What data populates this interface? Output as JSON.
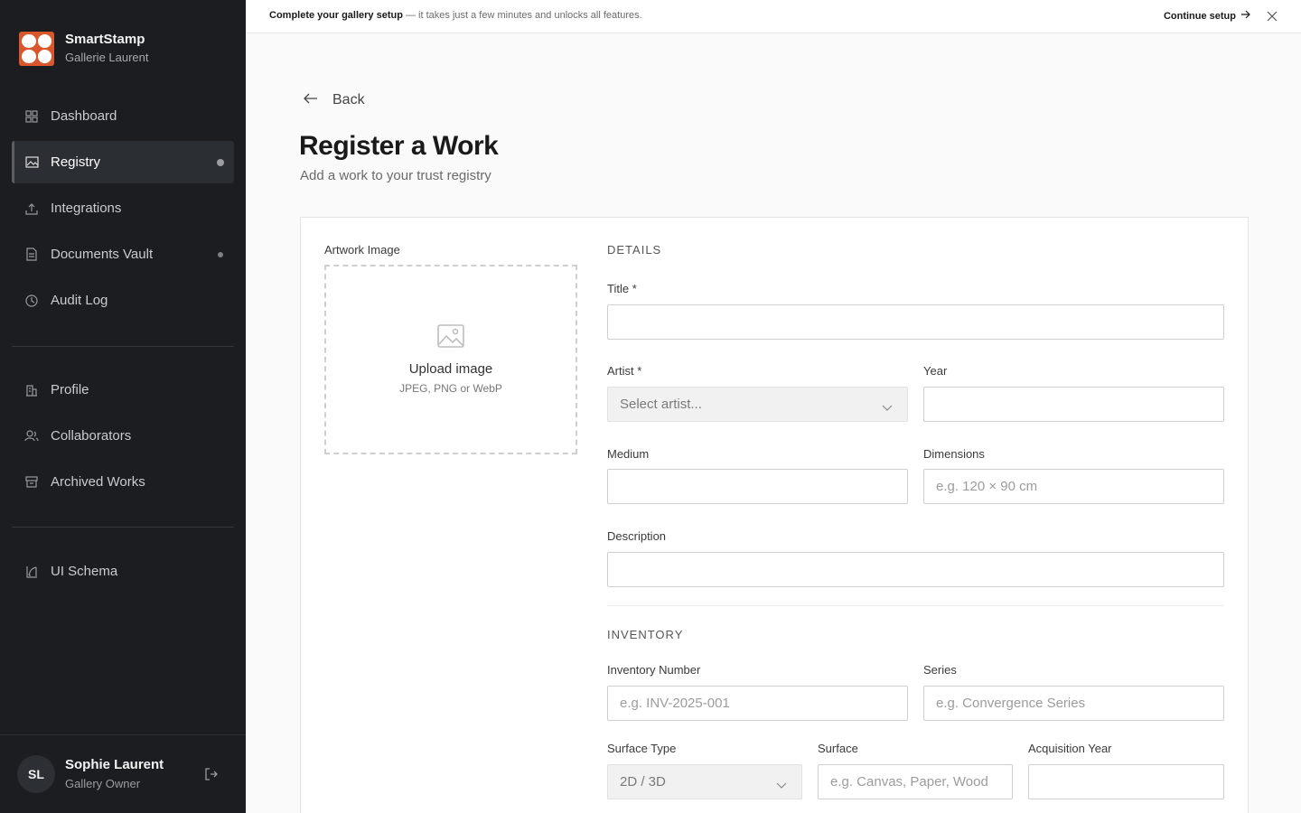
{
  "brand": {
    "name": "SmartStamp",
    "org": "Gallerie Laurent",
    "accent": "#d9572d"
  },
  "nav": {
    "primary": [
      {
        "label": "Dashboard",
        "icon": "grid-icon"
      },
      {
        "label": "Registry",
        "icon": "image-icon",
        "active": true
      },
      {
        "label": "Integrations",
        "icon": "upload-icon"
      },
      {
        "label": "Documents Vault",
        "icon": "document-icon"
      },
      {
        "label": "Audit Log",
        "icon": "clock-icon"
      }
    ],
    "secondary": [
      {
        "label": "Profile",
        "icon": "building-icon"
      },
      {
        "label": "Collaborators",
        "icon": "users-icon"
      },
      {
        "label": "Archived Works",
        "icon": "archive-icon"
      }
    ],
    "tertiary": [
      {
        "label": "UI Schema",
        "icon": "schema-icon"
      }
    ]
  },
  "user": {
    "initials": "SL",
    "name": "Sophie Laurent",
    "role": "Gallery Owner"
  },
  "banner": {
    "strong": "Complete your gallery setup",
    "rest": " — it takes just a few minutes and unlocks all features.",
    "action": "Continue setup"
  },
  "header": {
    "back": "Back",
    "title": "Register a Work",
    "subtitle": "Add a work to your trust registry"
  },
  "form": {
    "image_label": "Artwork Image",
    "upload_title": "Upload image",
    "upload_sub": "JPEG, PNG or WebP",
    "details_heading": "DETAILS",
    "title_label": "Title *",
    "artist_label": "Artist *",
    "artist_placeholder": "Select artist...",
    "year_label": "Year",
    "medium_label": "Medium",
    "dimensions_label": "Dimensions",
    "dimensions_placeholder": "e.g. 120 × 90 cm",
    "description_label": "Description",
    "inventory_heading": "INVENTORY",
    "inventory_number_label": "Inventory Number",
    "inventory_number_placeholder": "e.g. INV-2025-001",
    "series_label": "Series",
    "series_placeholder": "e.g. Convergence Series",
    "surface_type_label": "Surface Type",
    "surface_type_value": "2D / 3D",
    "surface_label": "Surface",
    "surface_placeholder": "e.g. Canvas, Paper, Wood",
    "acquisition_year_label": "Acquisition Year"
  }
}
